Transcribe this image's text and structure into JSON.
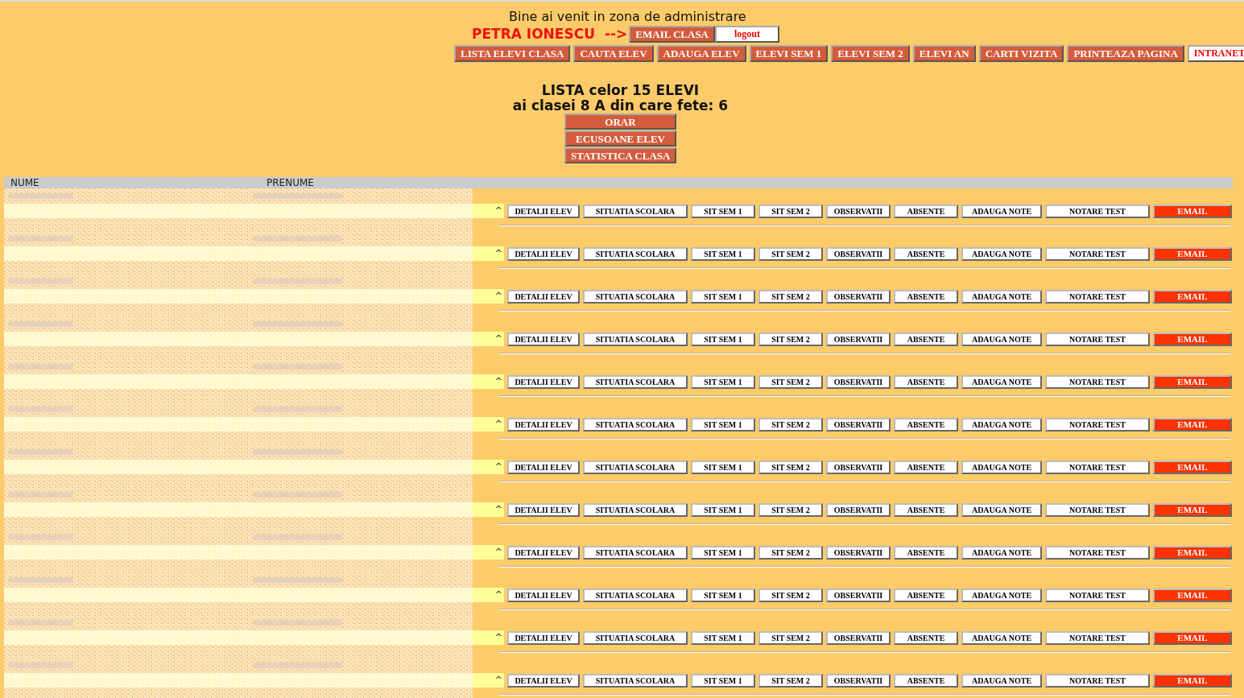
{
  "welcome": "Bine ai venit in zona de administrare",
  "user": {
    "name": "PETRA IONESCU",
    "arrow": "-->"
  },
  "user_buttons": [
    {
      "label": "EMAIL CLASA",
      "kind": "dark"
    },
    {
      "label": "logout",
      "kind": "light"
    }
  ],
  "nav": [
    {
      "label": "LISTA ELEVI CLASA",
      "kind": "dark"
    },
    {
      "label": "CAUTA ELEV",
      "kind": "dark"
    },
    {
      "label": "ADAUGA ELEV",
      "kind": "dark"
    },
    {
      "label": "ELEVI SEM 1",
      "kind": "dark"
    },
    {
      "label": "ELEVI SEM 2",
      "kind": "dark"
    },
    {
      "label": "ELEVI AN",
      "kind": "dark"
    },
    {
      "label": "CARTI VIZITA",
      "kind": "dark"
    },
    {
      "label": "PRINTEAZA PAGINA",
      "kind": "dark"
    },
    {
      "label": "INTRANET",
      "kind": "light"
    }
  ],
  "title_lines": [
    "LISTA celor 15 ELEVI",
    "ai clasei 8 A din care fete: 6"
  ],
  "class_buttons": [
    "ORAR",
    "ECUSOANE ELEV",
    "STATISTICA CLASA"
  ],
  "table": {
    "columns": [
      "NUME",
      "PRENUME"
    ],
    "rows": [
      {
        "mark": "^",
        "actions": [
          {
            "label": "DETALII ELEV",
            "kind": "plain"
          },
          {
            "label": "SITUATIA SCOLARA",
            "kind": "plain"
          },
          {
            "label": "SIT SEM 1",
            "kind": "plain"
          },
          {
            "label": "SIT SEM 2",
            "kind": "plain"
          },
          {
            "label": "OBSERVATII",
            "kind": "plain"
          },
          {
            "label": "ABSENTE",
            "kind": "plain"
          },
          {
            "label": "ADAUGA NOTE",
            "kind": "plain"
          },
          {
            "label": "NOTARE TEST",
            "kind": "plain"
          },
          {
            "label": "EMAIL",
            "kind": "email"
          }
        ]
      },
      {
        "mark": "^",
        "actions": [
          {
            "label": "DETALII ELEV",
            "kind": "plain"
          },
          {
            "label": "SITUATIA SCOLARA",
            "kind": "plain"
          },
          {
            "label": "SIT SEM 1",
            "kind": "plain"
          },
          {
            "label": "SIT SEM 2",
            "kind": "plain"
          },
          {
            "label": "OBSERVATII",
            "kind": "plain"
          },
          {
            "label": "ABSENTE",
            "kind": "plain"
          },
          {
            "label": "ADAUGA NOTE",
            "kind": "plain"
          },
          {
            "label": "NOTARE TEST",
            "kind": "plain"
          },
          {
            "label": "EMAIL",
            "kind": "email"
          }
        ]
      },
      {
        "mark": "^",
        "actions": [
          {
            "label": "DETALII ELEV",
            "kind": "plain"
          },
          {
            "label": "SITUATIA SCOLARA",
            "kind": "plain"
          },
          {
            "label": "SIT SEM 1",
            "kind": "plain"
          },
          {
            "label": "SIT SEM 2",
            "kind": "plain"
          },
          {
            "label": "OBSERVATII",
            "kind": "plain"
          },
          {
            "label": "ABSENTE",
            "kind": "plain"
          },
          {
            "label": "ADAUGA NOTE",
            "kind": "plain"
          },
          {
            "label": "NOTARE TEST",
            "kind": "plain"
          },
          {
            "label": "EMAIL",
            "kind": "email"
          }
        ]
      },
      {
        "mark": "^",
        "actions": [
          {
            "label": "DETALII ELEV",
            "kind": "plain"
          },
          {
            "label": "SITUATIA SCOLARA",
            "kind": "plain"
          },
          {
            "label": "SIT SEM 1",
            "kind": "plain"
          },
          {
            "label": "SIT SEM 2",
            "kind": "plain"
          },
          {
            "label": "OBSERVATII",
            "kind": "plain"
          },
          {
            "label": "ABSENTE",
            "kind": "plain"
          },
          {
            "label": "ADAUGA NOTE",
            "kind": "plain"
          },
          {
            "label": "NOTARE TEST",
            "kind": "plain"
          },
          {
            "label": "EMAIL",
            "kind": "email"
          }
        ]
      },
      {
        "mark": "^",
        "actions": [
          {
            "label": "DETALII ELEV",
            "kind": "plain"
          },
          {
            "label": "SITUATIA SCOLARA",
            "kind": "plain"
          },
          {
            "label": "SIT SEM 1",
            "kind": "plain"
          },
          {
            "label": "SIT SEM 2",
            "kind": "plain"
          },
          {
            "label": "OBSERVATII",
            "kind": "plain"
          },
          {
            "label": "ABSENTE",
            "kind": "plain"
          },
          {
            "label": "ADAUGA NOTE",
            "kind": "plain"
          },
          {
            "label": "NOTARE TEST",
            "kind": "plain"
          },
          {
            "label": "EMAIL",
            "kind": "email"
          }
        ]
      },
      {
        "mark": "^",
        "actions": [
          {
            "label": "DETALII ELEV",
            "kind": "plain"
          },
          {
            "label": "SITUATIA SCOLARA",
            "kind": "plain"
          },
          {
            "label": "SIT SEM 1",
            "kind": "plain"
          },
          {
            "label": "SIT SEM 2",
            "kind": "plain"
          },
          {
            "label": "OBSERVATII",
            "kind": "plain"
          },
          {
            "label": "ABSENTE",
            "kind": "plain"
          },
          {
            "label": "ADAUGA NOTE",
            "kind": "plain"
          },
          {
            "label": "NOTARE TEST",
            "kind": "plain"
          },
          {
            "label": "EMAIL",
            "kind": "email"
          }
        ]
      },
      {
        "mark": "^",
        "actions": [
          {
            "label": "DETALII ELEV",
            "kind": "plain"
          },
          {
            "label": "SITUATIA SCOLARA",
            "kind": "plain"
          },
          {
            "label": "SIT SEM 1",
            "kind": "plain"
          },
          {
            "label": "SIT SEM 2",
            "kind": "plain"
          },
          {
            "label": "OBSERVATII",
            "kind": "plain"
          },
          {
            "label": "ABSENTE",
            "kind": "plain"
          },
          {
            "label": "ADAUGA NOTE",
            "kind": "plain"
          },
          {
            "label": "NOTARE TEST",
            "kind": "plain"
          },
          {
            "label": "EMAIL",
            "kind": "email"
          }
        ]
      },
      {
        "mark": "^",
        "actions": [
          {
            "label": "DETALII ELEV",
            "kind": "plain"
          },
          {
            "label": "SITUATIA SCOLARA",
            "kind": "plain"
          },
          {
            "label": "SIT SEM 1",
            "kind": "plain"
          },
          {
            "label": "SIT SEM 2",
            "kind": "plain"
          },
          {
            "label": "OBSERVATII",
            "kind": "plain"
          },
          {
            "label": "ABSENTE",
            "kind": "plain"
          },
          {
            "label": "ADAUGA NOTE",
            "kind": "plain"
          },
          {
            "label": "NOTARE TEST",
            "kind": "plain"
          },
          {
            "label": "EMAIL",
            "kind": "email"
          }
        ]
      },
      {
        "mark": "^",
        "actions": [
          {
            "label": "DETALII ELEV",
            "kind": "plain"
          },
          {
            "label": "SITUATIA SCOLARA",
            "kind": "plain"
          },
          {
            "label": "SIT SEM 1",
            "kind": "plain"
          },
          {
            "label": "SIT SEM 2",
            "kind": "plain"
          },
          {
            "label": "OBSERVATII",
            "kind": "plain"
          },
          {
            "label": "ABSENTE",
            "kind": "plain"
          },
          {
            "label": "ADAUGA NOTE",
            "kind": "plain"
          },
          {
            "label": "NOTARE TEST",
            "kind": "plain"
          },
          {
            "label": "EMAIL",
            "kind": "email"
          }
        ]
      },
      {
        "mark": "^",
        "actions": [
          {
            "label": "DETALII ELEV",
            "kind": "plain"
          },
          {
            "label": "SITUATIA SCOLARA",
            "kind": "plain"
          },
          {
            "label": "SIT SEM 1",
            "kind": "plain"
          },
          {
            "label": "SIT SEM 2",
            "kind": "plain"
          },
          {
            "label": "OBSERVATII",
            "kind": "plain"
          },
          {
            "label": "ABSENTE",
            "kind": "plain"
          },
          {
            "label": "ADAUGA NOTE",
            "kind": "plain"
          },
          {
            "label": "NOTARE TEST",
            "kind": "plain"
          },
          {
            "label": "EMAIL",
            "kind": "email"
          }
        ]
      },
      {
        "mark": "^",
        "actions": [
          {
            "label": "DETALII ELEV",
            "kind": "plain"
          },
          {
            "label": "SITUATIA SCOLARA",
            "kind": "plain"
          },
          {
            "label": "SIT SEM 1",
            "kind": "plain"
          },
          {
            "label": "SIT SEM 2",
            "kind": "plain"
          },
          {
            "label": "OBSERVATII",
            "kind": "plain"
          },
          {
            "label": "ABSENTE",
            "kind": "plain"
          },
          {
            "label": "ADAUGA NOTE",
            "kind": "plain"
          },
          {
            "label": "NOTARE TEST",
            "kind": "plain"
          },
          {
            "label": "EMAIL",
            "kind": "email"
          }
        ]
      },
      {
        "mark": "^",
        "actions": [
          {
            "label": "DETALII ELEV",
            "kind": "plain"
          },
          {
            "label": "SITUATIA SCOLARA",
            "kind": "plain"
          },
          {
            "label": "SIT SEM 1",
            "kind": "plain"
          },
          {
            "label": "SIT SEM 2",
            "kind": "plain"
          },
          {
            "label": "OBSERVATII",
            "kind": "plain"
          },
          {
            "label": "ABSENTE",
            "kind": "plain"
          },
          {
            "label": "ADAUGA NOTE",
            "kind": "plain"
          },
          {
            "label": "NOTARE TEST",
            "kind": "plain"
          },
          {
            "label": "EMAIL",
            "kind": "email"
          }
        ]
      }
    ]
  }
}
